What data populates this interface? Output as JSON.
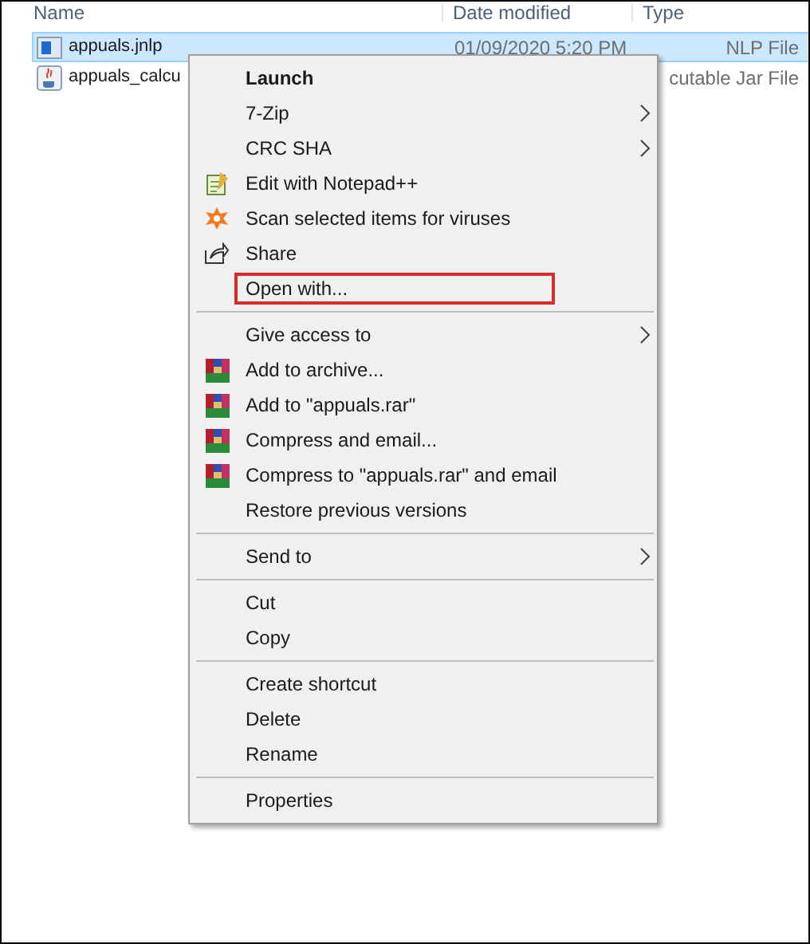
{
  "columns": [
    {
      "label": "Name"
    },
    {
      "label": "Date modified"
    },
    {
      "label": "Type"
    }
  ],
  "files": [
    {
      "name": "appuals.jnlp",
      "date": "01/09/2020 5:20 PM",
      "type": "NLP File",
      "selected": true
    },
    {
      "name": "appuals_calcu",
      "type": "cutable Jar File",
      "selected": false
    }
  ],
  "menu": {
    "groups": [
      [
        {
          "label": "Launch",
          "bold": true,
          "submenu": false,
          "outlined": false
        },
        {
          "label": "7-Zip",
          "bold": false,
          "submenu": true,
          "outlined": false
        },
        {
          "label": "CRC SHA",
          "bold": false,
          "submenu": true,
          "outlined": false
        },
        {
          "label": "Edit with Notepad++",
          "bold": false,
          "submenu": false,
          "outlined": false
        },
        {
          "label": "Scan selected items for viruses",
          "bold": false,
          "submenu": false,
          "outlined": false
        },
        {
          "label": "Share",
          "bold": false,
          "submenu": false,
          "outlined": false
        },
        {
          "label": "Open with...",
          "bold": false,
          "submenu": false,
          "outlined": true
        }
      ],
      [
        {
          "label": "Give access to",
          "bold": false,
          "submenu": true,
          "outlined": false
        },
        {
          "label": "Add to archive...",
          "bold": false,
          "submenu": false,
          "outlined": false
        },
        {
          "label": "Add to \"appuals.rar\"",
          "bold": false,
          "submenu": false,
          "outlined": false
        },
        {
          "label": "Compress and email...",
          "bold": false,
          "submenu": false,
          "outlined": false
        },
        {
          "label": "Compress to \"appuals.rar\" and email",
          "bold": false,
          "submenu": false,
          "outlined": false
        },
        {
          "label": "Restore previous versions",
          "bold": false,
          "submenu": false,
          "outlined": false
        }
      ],
      [
        {
          "label": "Send to",
          "bold": false,
          "submenu": true,
          "outlined": false
        }
      ],
      [
        {
          "label": "Cut",
          "bold": false,
          "submenu": false,
          "outlined": false
        },
        {
          "label": "Copy",
          "bold": false,
          "submenu": false,
          "outlined": false
        }
      ],
      [
        {
          "label": "Create shortcut",
          "bold": false,
          "submenu": false,
          "outlined": false
        },
        {
          "label": "Delete",
          "bold": false,
          "submenu": false,
          "outlined": false
        },
        {
          "label": "Rename",
          "bold": false,
          "submenu": false,
          "outlined": false
        }
      ],
      [
        {
          "label": "Properties",
          "bold": false,
          "submenu": false,
          "outlined": false
        }
      ]
    ]
  }
}
